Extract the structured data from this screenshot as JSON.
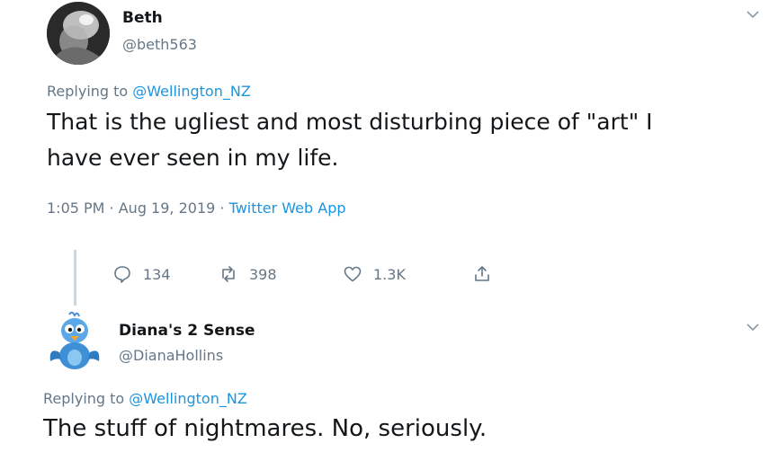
{
  "tweet1": {
    "name": "Beth",
    "handle": "@beth563",
    "replying_prefix": "Replying to ",
    "replying_to": "@Wellington_NZ",
    "text_line1": "That is the ugliest and most disturbing piece of \"art\" I",
    "text_line2": "have ever seen in my life.",
    "time_date": "1:05 PM · Aug 19, 2019 · ",
    "app": "Twitter Web App",
    "replies": "134",
    "retweets": "398",
    "likes": "1.3K"
  },
  "tweet2": {
    "name": "Diana's 2 Sense",
    "handle": "@DianaHollins",
    "replying_prefix": "Replying to ",
    "replying_to": "@Wellington_NZ",
    "text": "The stuff of nightmares. No, seriously."
  },
  "icons": {
    "chevron": "chevron-down-icon",
    "reply": "reply-icon",
    "retweet": "retweet-icon",
    "like": "heart-icon",
    "share": "share-icon"
  },
  "colors": {
    "link": "#1b95e0",
    "secondary": "#657786",
    "text": "#14171a"
  }
}
